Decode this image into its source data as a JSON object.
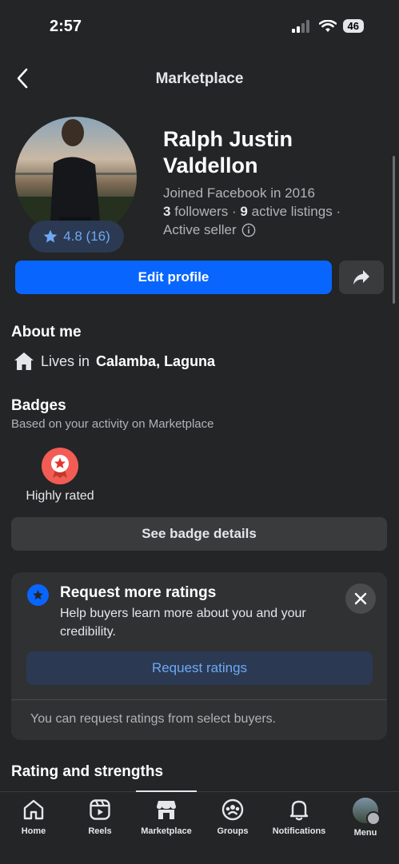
{
  "status_bar": {
    "time": "2:57",
    "battery": "46"
  },
  "header": {
    "title": "Marketplace"
  },
  "profile": {
    "rating": "4.8 (16)",
    "name": "Ralph Justin Valdellon",
    "joined": "Joined Facebook in 2016",
    "followers_count": "3",
    "followers_label": "followers",
    "listings_count": "9",
    "listings_label": "active listings",
    "seller_status": "Active seller",
    "edit_label": "Edit profile"
  },
  "about": {
    "title": "About me",
    "lives_prefix": "Lives in",
    "location": "Calamba, Laguna"
  },
  "badges": {
    "title": "Badges",
    "subtitle": "Based on your activity on Marketplace",
    "items": [
      {
        "label": "Highly rated",
        "icon": "star-medal-icon",
        "color": "#f25c54"
      }
    ],
    "details_label": "See badge details"
  },
  "ratings_card": {
    "title": "Request more ratings",
    "description": "Help buyers learn more about you and your credibility.",
    "button_label": "Request ratings",
    "footer": "You can request ratings from select buyers."
  },
  "section_next": {
    "title": "Rating and strengths"
  },
  "tabs": [
    {
      "label": "Home",
      "icon": "home-icon"
    },
    {
      "label": "Reels",
      "icon": "reels-icon"
    },
    {
      "label": "Marketplace",
      "icon": "marketplace-icon",
      "active": true
    },
    {
      "label": "Groups",
      "icon": "groups-icon"
    },
    {
      "label": "Notifications",
      "icon": "bell-icon"
    },
    {
      "label": "Menu",
      "icon": "profile-avatar-icon"
    }
  ],
  "colors": {
    "accent": "#0866ff",
    "background": "#242526",
    "badge": "#f25c54"
  }
}
